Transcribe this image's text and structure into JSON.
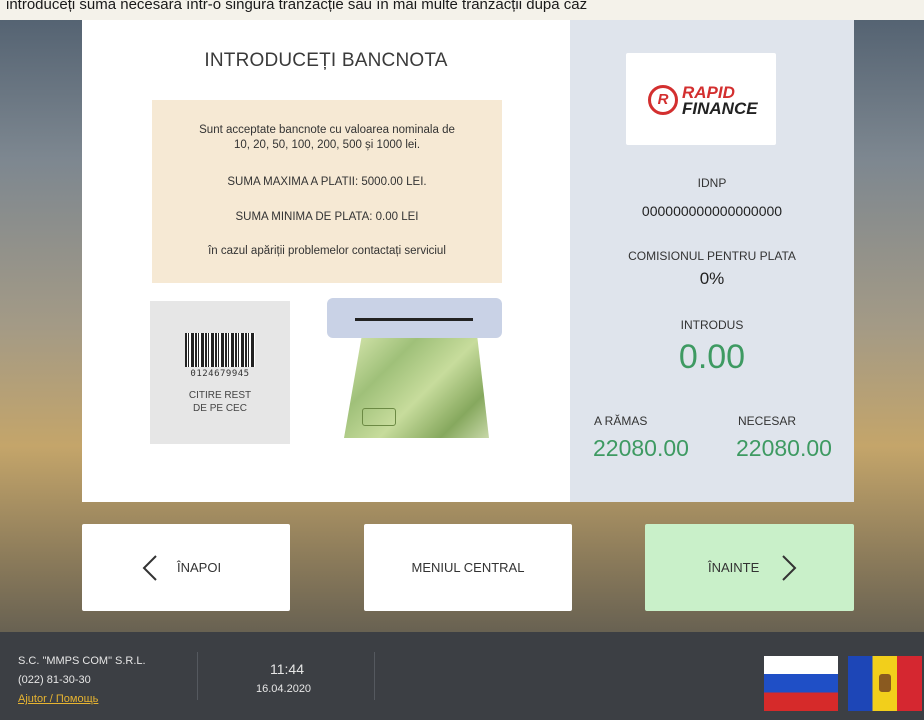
{
  "top_strip": {
    "text": "introduceți suma necesară într-o singură tranzacție sau în mai multe tranzacții după caz"
  },
  "left_panel": {
    "title": "INTRODUCEȚI BANCNOTA",
    "info_lines": [
      "Sunt acceptate bancnote cu valoarea nominala de",
      "10, 20, 50, 100, 200, 500 și 1000 lei.",
      "SUMA MAXIMA A PLATII: 5000.00 LEI.",
      "SUMA MINIMA DE PLATA: 0.00 LEI",
      "în cazul apăriții problemelor contactați serviciul"
    ],
    "barcode_number": "0124679945",
    "barcode_label_1": "CITIRE REST",
    "barcode_label_2": "DE PE CEC"
  },
  "right_panel": {
    "logo_text_1": "RAPID",
    "logo_text_2": "FINANCE",
    "idnp_label": "IDNP",
    "idnp_value": "000000000000000000",
    "commission_label": "COMISIONUL PENTRU PLATA",
    "commission_value": "0%",
    "inserted_label": "INTRODUS",
    "inserted_value": "0.00",
    "remaining_label": "A RĂMAS",
    "remaining_value": "22080.00",
    "required_label": "NECESAR",
    "required_value": "22080.00",
    "accent_color": "#3e9a62"
  },
  "buttons": {
    "back": "ÎNAPOI",
    "menu": "MENIUL CENTRAL",
    "next": "ÎNAINTE"
  },
  "footer": {
    "company": "S.C. \"MMPS COM\" S.R.L.",
    "phone": "(022) 81-30-30",
    "help": "Ajutor / Помощь",
    "time": "11:44",
    "date": "16.04.2020",
    "languages": [
      "Русский",
      "Română"
    ]
  }
}
